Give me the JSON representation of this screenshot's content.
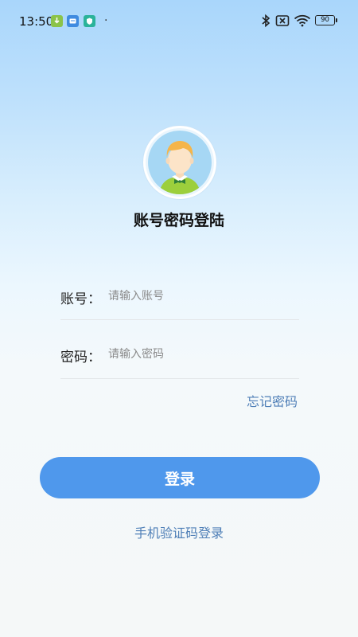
{
  "status_bar": {
    "time": "13:50",
    "battery": "90",
    "icons": [
      "download-icon",
      "message-app-icon",
      "shield-app-icon",
      "bluetooth-icon",
      "no-sim-icon",
      "wifi-icon",
      "battery-icon"
    ]
  },
  "login": {
    "title": "账号密码登陆",
    "account_label": "账号：",
    "account_placeholder": "请输入账号",
    "account_value": "",
    "password_label": "密码：",
    "password_placeholder": "请输入密码",
    "password_value": "",
    "forgot_password": "忘记密码",
    "login_button": "登录",
    "sms_login": "手机验证码登录"
  },
  "colors": {
    "primary": "#4f98ec",
    "link": "#4f7fb7",
    "gradient_top": "#a9d6fb",
    "background": "#f5f8f8"
  }
}
